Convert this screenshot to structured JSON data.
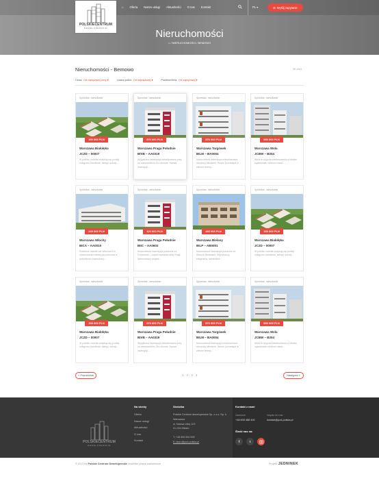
{
  "header": {
    "logo_text": "POLSKIECENTRUM",
    "logo_sub": "DEWELOPERSKIE",
    "nav": [
      "Oferta",
      "Nasze usługi",
      "Aktualności",
      "O nas",
      "Kontakt"
    ],
    "lang": "PL",
    "cta_label": "Wyślij zapytanie",
    "title": "Nieruchomości",
    "breadcrumb": "/ NIERUCHOMOŚCI / BEMOWO",
    "accent": "#e84a3f"
  },
  "listing": {
    "title": "Nieruchomości - Bemowo",
    "count": "36 ofert",
    "filters": [
      {
        "label": "Cena:",
        "value": "Od najwyższej ceny"
      },
      {
        "label": "Liczba pokoi:",
        "value": "Od największej"
      },
      {
        "label": "Powierzchnia:",
        "value": "Od najwyższej"
      }
    ]
  },
  "cards": [
    {
      "cat": "Sprzedaż, mieszkanie",
      "price": "190 000 PLN",
      "t1": "Warszawa Białołęka",
      "t2": "JCZD – 00007",
      "desc": "W pobliżu osiedla znajdują się punkty usługowo-handlowe, sklepy, szkoły...",
      "img": "aerial",
      "active": false
    },
    {
      "cat": "Sprzedaż, mieszkanie",
      "price": "876 000 PLN",
      "t1": "Warszawa Praga Południe",
      "t2": "BIVB – AA0319",
      "desc": "Wyjątkowa inwestycja zlokalizowana przy na warszawskim Gro-chowie. Nazwa inwestycji...",
      "img": "modern",
      "active": true
    },
    {
      "cat": "Sprzedaż, mieszkanie",
      "price": "876 000 PLN",
      "t1": "Warszawa Targówek",
      "t2": "BILM – BA0004",
      "desc": "Nowoczesna inwestycja mieszkaniowa otoczony klimatem. Wsum porośnięta w zielone tereny...",
      "img": "white",
      "active": false
    },
    {
      "cat": "Sprzedaż, mieszkanie",
      "price": "650 000 PLN",
      "t1": "Warszawa Wola",
      "t2": "JCBW – B204",
      "desc": "Wola to wygoda zamieszkania w bliskim sąsiedztwie centrum miast...",
      "img": "tower",
      "active": false
    },
    {
      "cat": "Sprzedaż, mieszkanie",
      "price": "249 000 PLN",
      "t1": "Warszawa Włochy",
      "t2": "BICA – AA0010",
      "desc": "Rodzinne osiedle we Włochach to nowoczesna inwestycja położona w południowo-zachodniej...",
      "img": "block",
      "active": false
    },
    {
      "cat": "Sprzedaż, mieszkanie",
      "price": "120 000 PLN",
      "t1": "Warszawa Praga Południe",
      "t2": "BIIC – AA0602",
      "desc": "Nowoczesna inwestycja położona na Grochowie – części warszaw-skiej Pragi. Nowoczesny projekt...",
      "img": "modern",
      "active": false
    },
    {
      "cat": "Sprzedaż, mieszkanie",
      "price": "450 000 PLN",
      "t1": "Warszawa Bielany",
      "t2": "BILP – AB0001",
      "desc": "Nowoczesna inwestycja położona na Starych Bielanach. Wyróżnia ją elegancka, kameralna...",
      "img": "beige",
      "active": false
    },
    {
      "cat": "Sprzedaż, mieszkanie",
      "price": "190 000 PLN",
      "t1": "Warszawa Białołęka",
      "t2": "JCZD – 00007",
      "desc": "W pobliżu osiedla znajdują się punkty usługowo-handlowe, sklepy, szkoły...",
      "img": "aerial",
      "active": false
    },
    {
      "cat": "Sprzedaż, mieszkanie",
      "price": "190 000 PLN",
      "t1": "Warszawa Białołęka",
      "t2": "JCZD – 00007",
      "desc": "W pobliżu osiedla znajdują się punkty usługowo-handlowe, sklepy, szkoły...",
      "img": "aerial",
      "active": false
    },
    {
      "cat": "Sprzedaż, mieszkanie",
      "price": "876 000 PLN",
      "t1": "Warszawa Praga Południe",
      "t2": "BIVB – AA0319",
      "desc": "Wyjątkowa inwestycja zlokalizowana przy na warszawskim Gro-chowie. Nazwa inwestycji...",
      "img": "modern",
      "active": false
    },
    {
      "cat": "Sprzedaż, mieszkanie",
      "price": "876 000 PLN",
      "t1": "Warszawa Targówek",
      "t2": "BILM – BA0004",
      "desc": "Nowoczesna inwestycja mieszkaniowa otoczony klimatem. Wsum porośnięta w zielone tereny...",
      "img": "white",
      "active": false
    },
    {
      "cat": "Sprzedaż, mieszkanie",
      "price": "650 000 PLN",
      "t1": "Warszawa Wola",
      "t2": "JCBW – B204",
      "desc": "Wola to wygoda zamieszkania w bliskim sąsiedztwie centrum miast...",
      "img": "tower",
      "active": false
    }
  ],
  "pagination": {
    "prev": "« Poprzednia",
    "next": "Następna »",
    "pages": "1 2 3 4"
  },
  "footer": {
    "logo_text": "POLSKIECENTRUM",
    "logo_sub": "DEWELOPERSKIE",
    "links_head": "Na skróty",
    "links": [
      "Oferta",
      "Nasze usługi",
      "Aktualności",
      "O nas",
      "Kontakt"
    ],
    "office_head": "Siedziba",
    "office_name": "Polskie Centrum deweloperskie Sp. z o.o. Sp. k. Warszawa",
    "street": "ul. Nazwa Ulicy 123",
    "city": "01-234 Miasto",
    "tel": "T: +48 500 500 500",
    "email": "E: biuro@pcd-polska.pl",
    "contact_head": "Kontakt z nami",
    "call_label": "Zadzwoń",
    "call_value": "+48 605 488 400",
    "mail_label": "Napisz do nas",
    "mail_value": "kontakt@pcd-polska.pl",
    "social_head": "Śledź nas na:",
    "social": [
      "f",
      "t",
      "ig"
    ],
    "copyright_pre": "© 2017 by",
    "copyright_brand": "Polskie Centrum Deweloperskie",
    "copyright_post": "Wszelkie prawa zastrzeżone",
    "maker_label": "Projekt",
    "maker_brand": "JEDNINEK"
  }
}
